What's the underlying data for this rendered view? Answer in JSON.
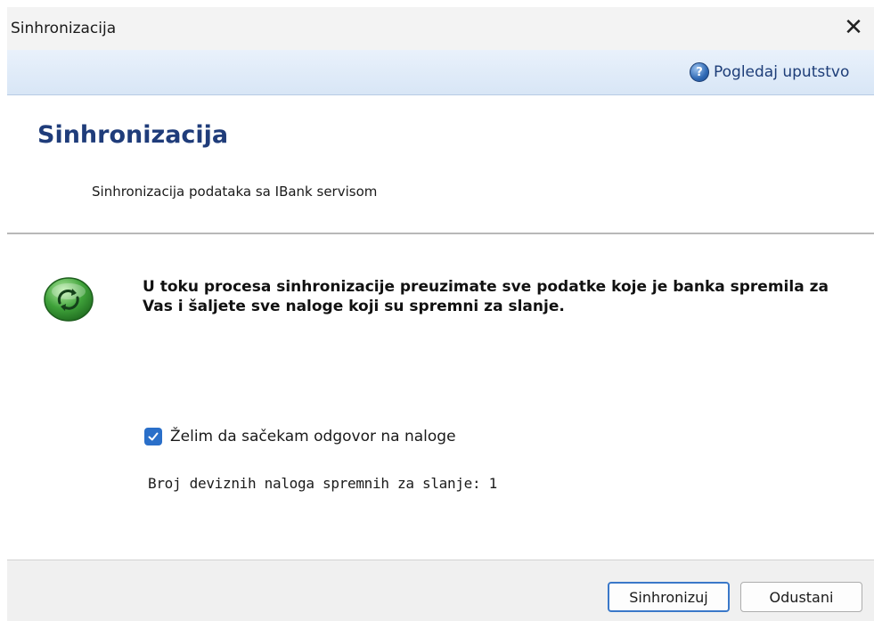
{
  "window": {
    "title": "Sinhronizacija",
    "close_glyph": "✕"
  },
  "helpbar": {
    "help_link_label": "Pogledaj uputstvo",
    "help_icon_glyph": "?"
  },
  "header": {
    "title": "Sinhronizacija",
    "subtitle": "Sinhronizacija podataka sa IBank servisom"
  },
  "content": {
    "info_text": "U toku procesa sinhronizacije preuzimate sve podatke koje je banka spremila za Vas i šaljete sve naloge koji su spremni za slanje.",
    "wait_checkbox_label": "Želim da sačekam odgovor na naloge",
    "wait_checkbox_checked": true,
    "foreign_orders_text": "Broj deviznih naloga spremnih za slanje: 1"
  },
  "footer": {
    "sync_button_label": "Sinhronizuj",
    "cancel_button_label": "Odustani"
  },
  "colors": {
    "title_blue": "#1f3c7a",
    "checkbox_blue": "#2a6fc9",
    "sync_icon_green": "#3fa23a"
  },
  "icons": [
    "close-icon",
    "help-icon",
    "sync-icon",
    "checkmark-icon"
  ]
}
